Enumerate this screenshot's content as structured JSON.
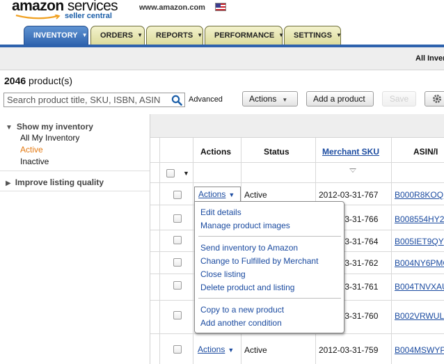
{
  "header": {
    "logo_main": "amazon",
    "logo_services": " services",
    "logo_sub": "seller central",
    "site_url": "www.amazon.com",
    "flag_icon": "us-flag-icon"
  },
  "tabs": [
    {
      "label": "INVENTORY",
      "active": true
    },
    {
      "label": "ORDERS",
      "active": false
    },
    {
      "label": "REPORTS",
      "active": false
    },
    {
      "label": "PERFORMANCE",
      "active": false
    },
    {
      "label": "SETTINGS",
      "active": false
    }
  ],
  "view_label": "All Inven",
  "product_count": {
    "number": "2046",
    "suffix": " product(s)"
  },
  "search": {
    "placeholder": "Search product title, SKU, ISBN, ASIN",
    "icon": "magnifier-icon"
  },
  "advanced_label": "Advanced",
  "toolbar": {
    "actions_label": "Actions",
    "add_product_label": "Add a product",
    "save_label": "Save"
  },
  "sidebar": {
    "show_inventory_title": "Show my inventory",
    "filters": [
      {
        "label": "All My Inventory",
        "active": false
      },
      {
        "label": "Active",
        "active": true
      },
      {
        "label": "Inactive",
        "active": false
      }
    ],
    "improve_title": "Improve listing quality"
  },
  "table": {
    "columns": {
      "actions": "Actions",
      "status": "Status",
      "sku": "Merchant SKU",
      "asin": "ASIN/I"
    },
    "rows": [
      {
        "action": "Actions",
        "status": "Active",
        "sku": "2012-03-31-767",
        "asin": "B000R8KOQ"
      },
      {
        "sku": "2012-03-31-766",
        "asin": "B008554HY2"
      },
      {
        "sku": "2012-03-31-764",
        "asin": "B005IET9QY"
      },
      {
        "sku": "2012-03-31-762",
        "asin": "B004NY6PMC"
      },
      {
        "sku": "2012-03-31-761",
        "asin": "B004TNVXAU"
      },
      {
        "sku": "2012-03-31-760",
        "asin": "B002VRWUL"
      },
      {
        "action": "Actions",
        "status": "Active",
        "sku": "2012-03-31-759",
        "asin": "B004MSWYP"
      }
    ]
  },
  "dropdown": {
    "groups": [
      [
        "Edit details",
        "Manage product images"
      ],
      [
        "Send inventory to Amazon",
        "Change to Fulfilled by Merchant",
        "Close listing",
        "Delete product and listing"
      ],
      [
        "Copy to a new product",
        "Add another condition"
      ]
    ]
  },
  "colors": {
    "tab_active": "#2e62ad",
    "tab_inactive": "#e8e7b4",
    "link": "#1b4ba0",
    "active_filter": "#e47911"
  }
}
